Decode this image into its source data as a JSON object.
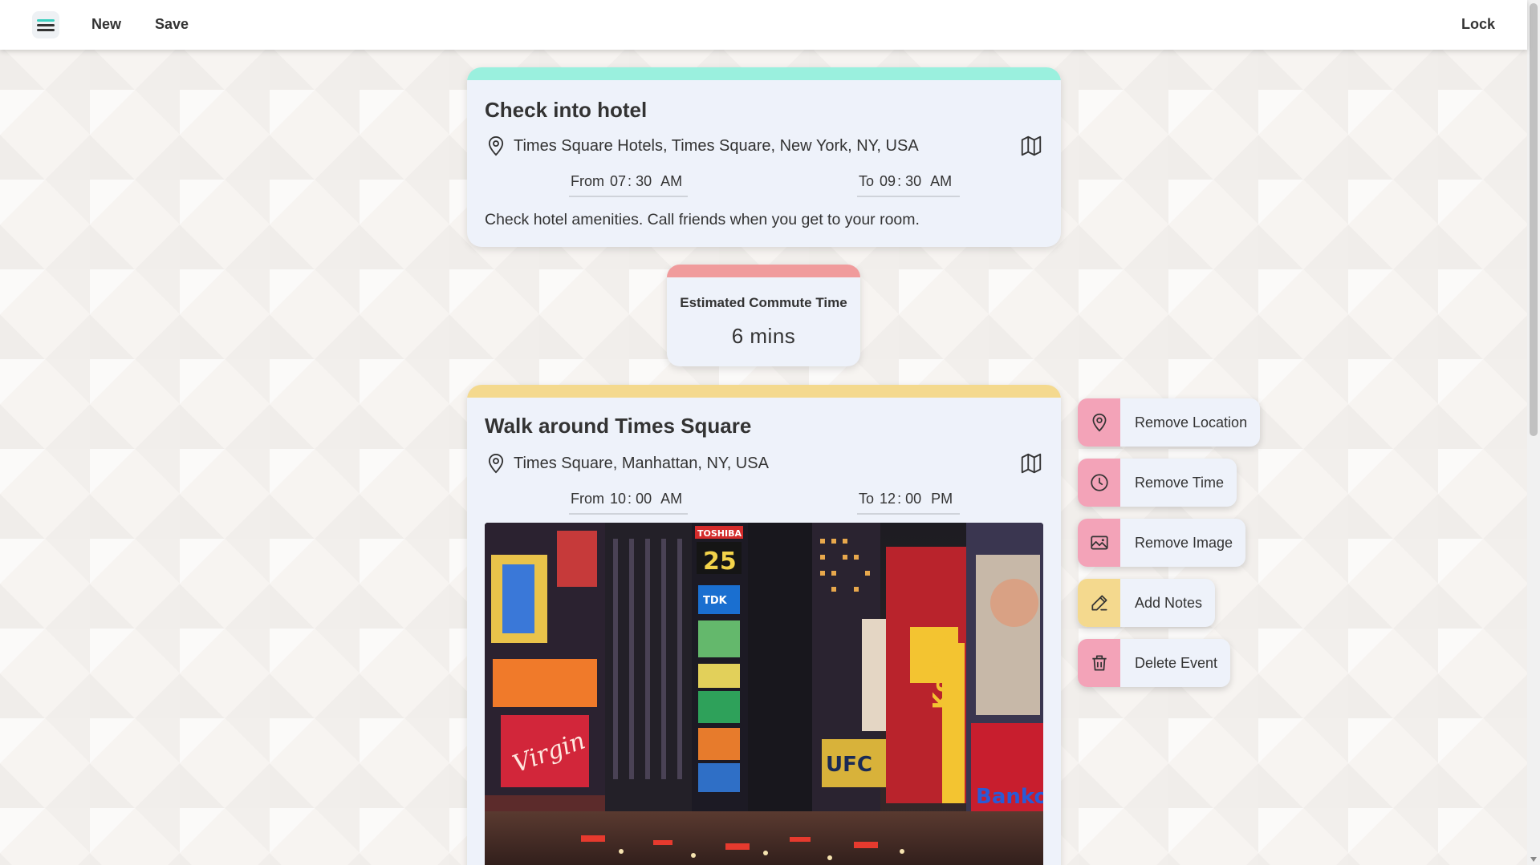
{
  "topbar": {
    "menu_icon": "hamburger-menu-icon",
    "new_label": "New",
    "save_label": "Save",
    "lock_label": "Lock"
  },
  "events": [
    {
      "title": "Check into hotel",
      "stripe_color": "#9af0de",
      "location": "Times Square Hotels, Times Square, New York, NY, USA",
      "from": {
        "prefix": "From",
        "hour": "07",
        "minute": "30",
        "ampm": "AM"
      },
      "to": {
        "prefix": "To",
        "hour": "09",
        "minute": "30",
        "ampm": "AM"
      },
      "notes": "Check hotel amenities. Call friends when you get to your room."
    },
    {
      "title": "Walk around Times Square",
      "stripe_color": "#f4d98e",
      "location": "Times Square, Manhattan, NY, USA",
      "from": {
        "prefix": "From",
        "hour": "10",
        "minute": "00",
        "ampm": "AM"
      },
      "to": {
        "prefix": "To",
        "hour": "12",
        "minute": "00",
        "ampm": "PM"
      },
      "image": "times-square-night-photo"
    }
  ],
  "commute": {
    "label": "Estimated Commute Time",
    "value": "6 mins",
    "stripe_color": "#f09b9c"
  },
  "actions": [
    {
      "label": "Remove Location",
      "icon": "location-pin-icon",
      "color": "#f3a3b8"
    },
    {
      "label": "Remove Time",
      "icon": "clock-icon",
      "color": "#f3a3b8"
    },
    {
      "label": "Remove Image",
      "icon": "image-icon",
      "color": "#f3a3b8"
    },
    {
      "label": "Add Notes",
      "icon": "edit-pencil-icon",
      "color": "#f4d98e"
    },
    {
      "label": "Delete Event",
      "icon": "trash-icon",
      "color": "#f3a3b8"
    }
  ]
}
